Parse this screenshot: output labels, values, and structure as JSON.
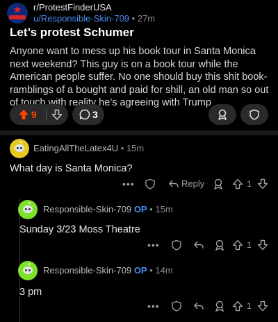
{
  "post": {
    "subreddit": "r/ProtestFinderUSA",
    "author": "u/Responsible-Skin-709",
    "age": "27m",
    "title": "Let’s protest Schumer",
    "body": "Anyone want to mess up his book tour in Santa Monica next weekend? This guy is on a book tour while the American people suffer. No one should buy this shit book- ramblings of a bought and paid for shill, an old man so out of touch with reality he’s agreeing with Trump",
    "votes": "9",
    "comments": "3"
  },
  "comments": [
    {
      "author": "EatingAllTheLatex4U",
      "op": "",
      "age": "15m",
      "text": "What day is Santa Monica?",
      "reply_label": "Reply",
      "votes": "1"
    },
    {
      "author": "Responsible-Skin-709",
      "op": "OP",
      "age": "15m",
      "text": "Sunday 3/23 Moss Theatre",
      "votes": "1"
    },
    {
      "author": "Responsible-Skin-709",
      "op": "OP",
      "age": "14m",
      "text": "3 pm",
      "votes": "1"
    }
  ],
  "meta_separator": "•",
  "more_label": "•••",
  "colors": {
    "upvote": "#ff4500",
    "link": "#4a8ff0",
    "background": "#000000"
  },
  "icons": [
    "upvote-icon",
    "downvote-icon",
    "comment-icon",
    "award-icon",
    "shield-icon",
    "reply-icon",
    "more-icon"
  ]
}
